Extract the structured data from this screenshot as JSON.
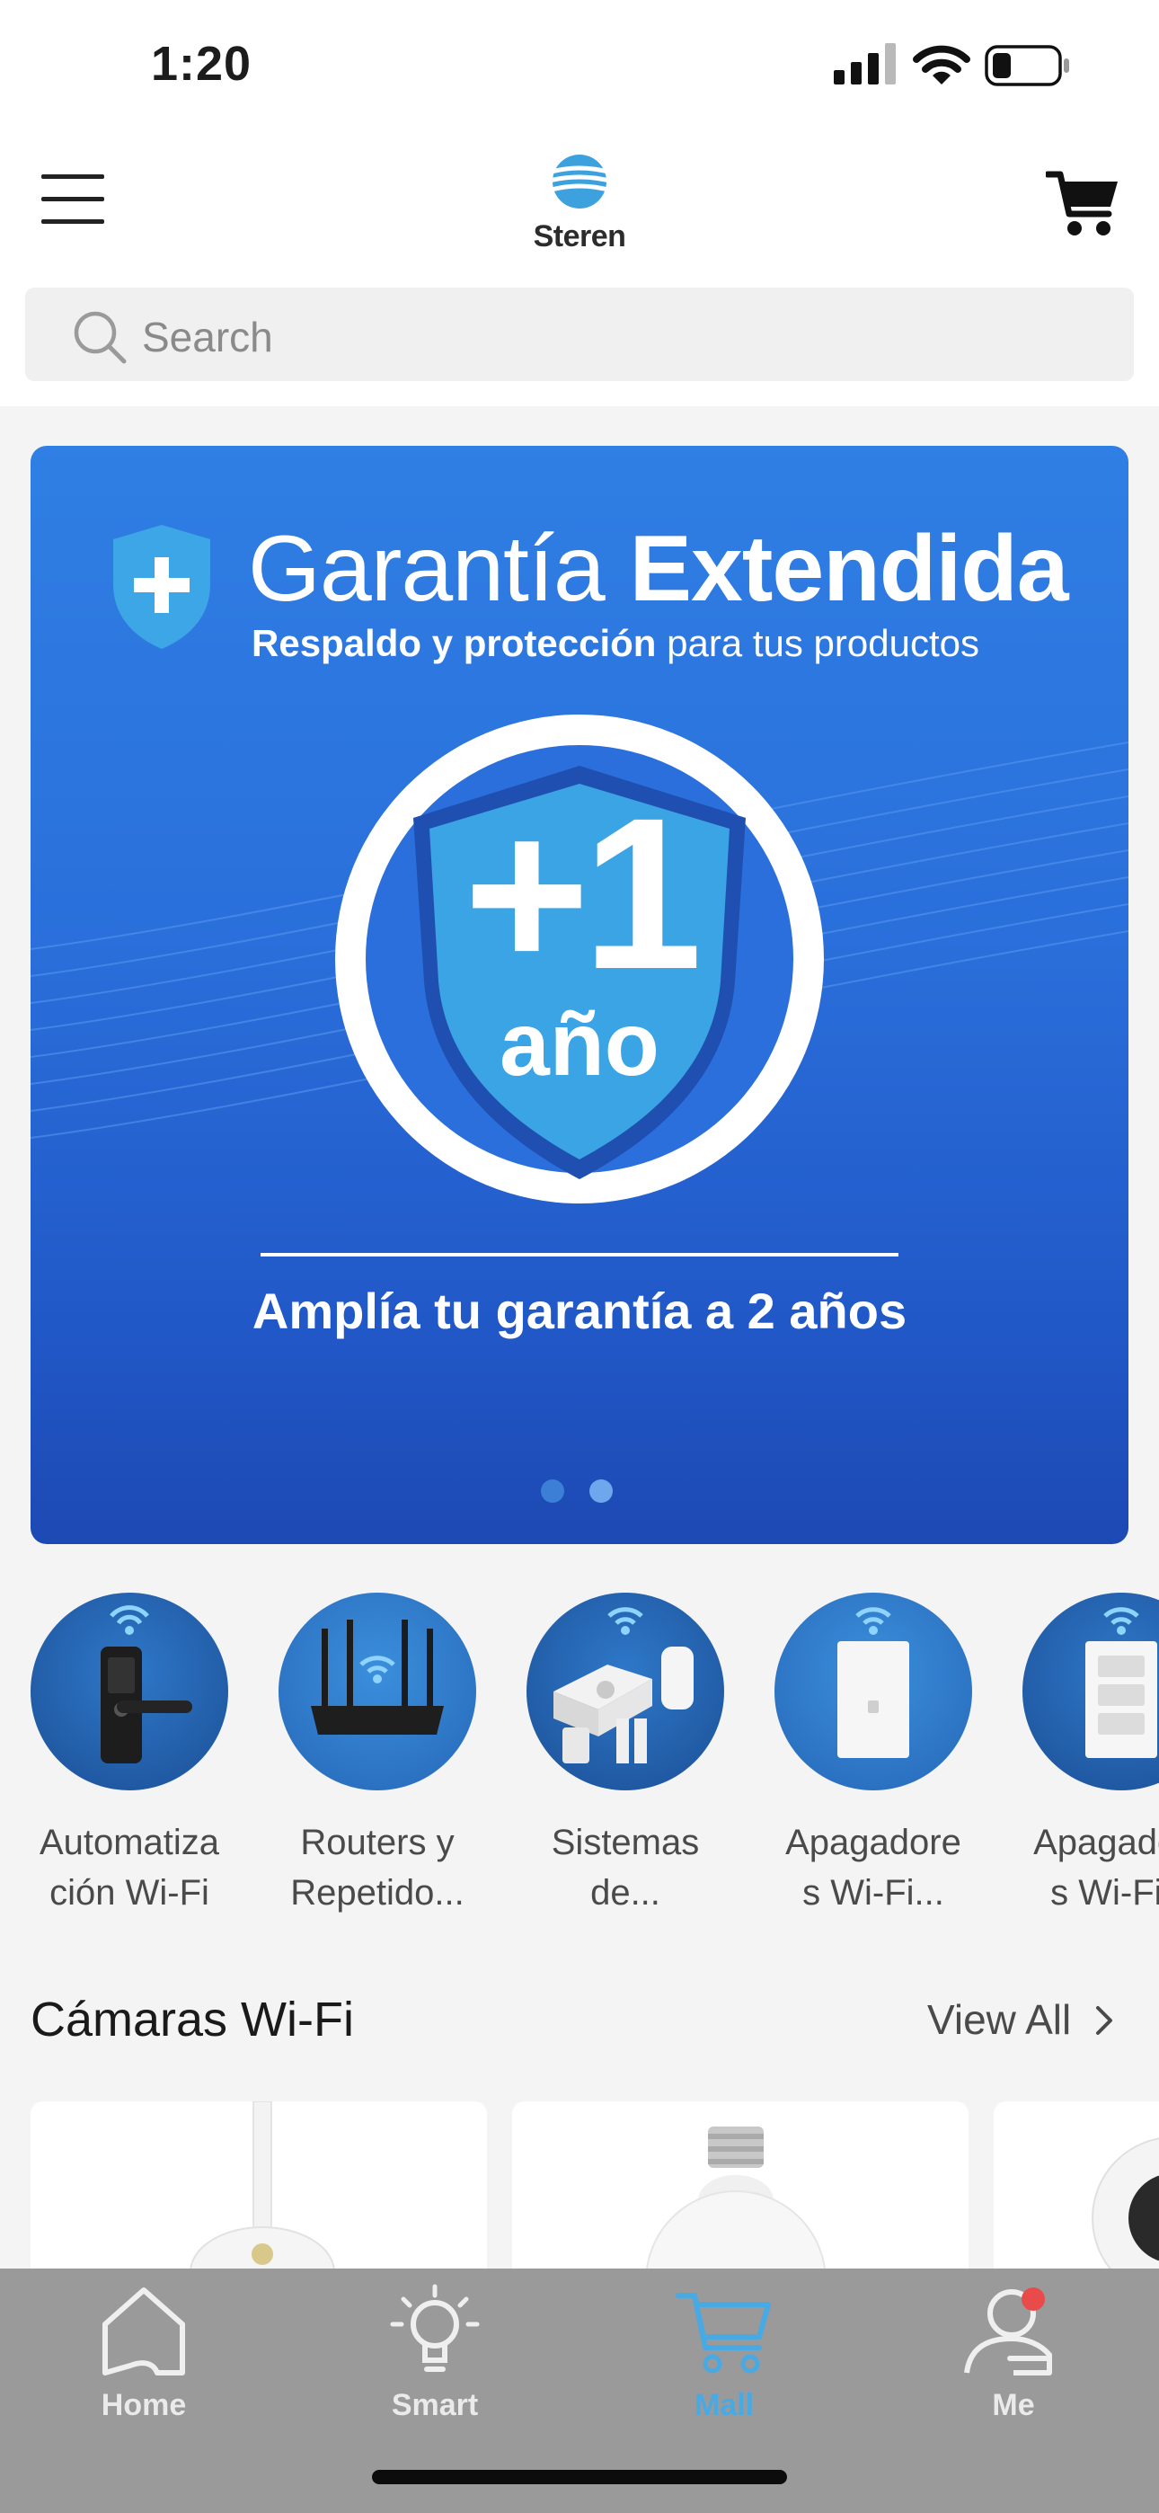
{
  "status_bar": {
    "time": "1:20"
  },
  "header": {
    "logo_text": "Steren"
  },
  "search": {
    "placeholder": "Search"
  },
  "banner": {
    "title_light": "Garantía ",
    "title_bold": "Extendida",
    "subtitle_bold": "Respaldo y protección",
    "subtitle_light": " para tus productos",
    "badge_main": "+1",
    "badge_unit": "año",
    "cta": "Amplía tu garantía a 2 años",
    "page_count": 2,
    "active_page": 2
  },
  "categories": [
    {
      "label_line1": "Automatiza",
      "label_line2": "ción Wi-Fi",
      "icon": "smart-lock-icon"
    },
    {
      "label_line1": "Routers y",
      "label_line2": "Repetido...",
      "icon": "router-icon"
    },
    {
      "label_line1": "Sistemas",
      "label_line2": "de...",
      "icon": "alarm-system-icon"
    },
    {
      "label_line1": "Apagadore",
      "label_line2": "s Wi-Fi...",
      "icon": "wall-switch-icon"
    },
    {
      "label_line1": "Apagadore",
      "label_line2": "s Wi-Fi...",
      "icon": "triple-switch-icon"
    }
  ],
  "section": {
    "title": "Cámaras Wi-Fi",
    "view_all": "View All"
  },
  "tabs": [
    {
      "label": "Home",
      "icon": "home-icon",
      "active": false
    },
    {
      "label": "Smart",
      "icon": "lightbulb-icon",
      "active": false
    },
    {
      "label": "Mall",
      "icon": "cart-icon",
      "active": true
    },
    {
      "label": "Me",
      "icon": "user-icon",
      "active": false
    }
  ],
  "colors": {
    "brand_blue": "#2a6fdb",
    "active_tab": "#49a9e3",
    "notification_dot": "#e94b4b"
  }
}
